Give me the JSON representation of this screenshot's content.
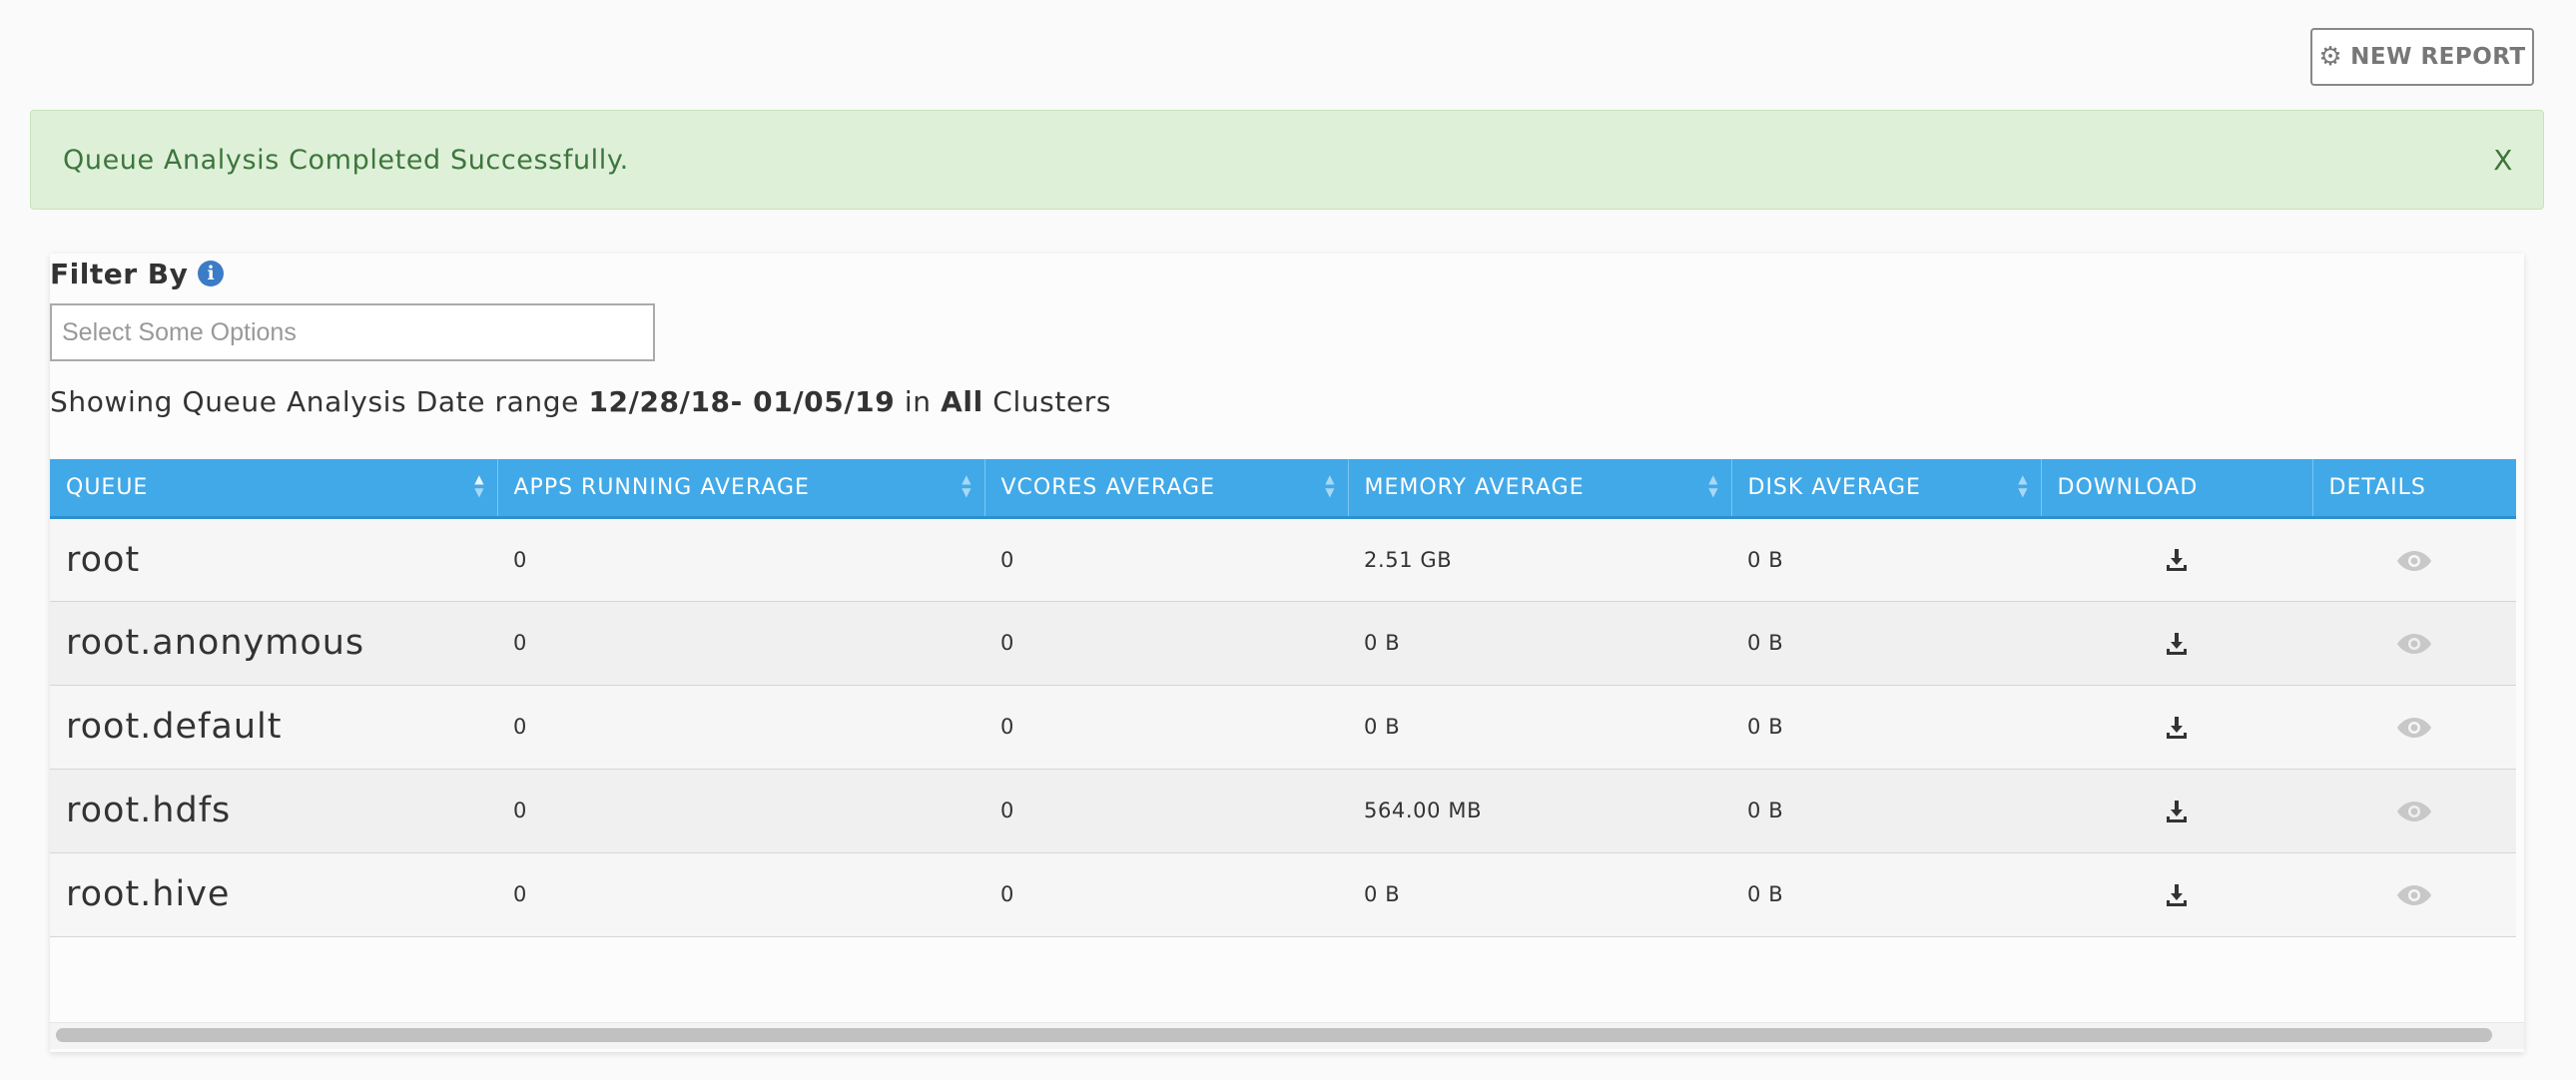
{
  "toolbar": {
    "new_report_label": "NEW REPORT",
    "new_report_icon": "gear-icon"
  },
  "alert": {
    "message": "Queue Analysis Completed Successfully.",
    "close_label": "X",
    "color": "#3c763d",
    "background": "#dff0d8"
  },
  "filter": {
    "label": "Filter By",
    "info_icon": "info-icon",
    "placeholder": "Select Some Options"
  },
  "summary": {
    "prefix": "Showing Queue Analysis Date range",
    "date_range": "12/28/18- 01/05/19",
    "in": "in",
    "scope": "All",
    "suffix": "Clusters"
  },
  "table": {
    "header_color": "#41a9e8",
    "columns": [
      "QUEUE",
      "APPS RUNNING AVERAGE",
      "VCORES AVERAGE",
      "MEMORY AVERAGE",
      "DISK AVERAGE",
      "DOWNLOAD",
      "DETAILS"
    ],
    "rows": [
      {
        "queue": "root",
        "apps": "0",
        "vcores": "0",
        "memory": "2.51 GB",
        "disk": "0 B"
      },
      {
        "queue": "root.anonymous",
        "apps": "0",
        "vcores": "0",
        "memory": "0 B",
        "disk": "0 B"
      },
      {
        "queue": "root.default",
        "apps": "0",
        "vcores": "0",
        "memory": "0 B",
        "disk": "0 B"
      },
      {
        "queue": "root.hdfs",
        "apps": "0",
        "vcores": "0",
        "memory": "564.00 MB",
        "disk": "0 B"
      },
      {
        "queue": "root.hive",
        "apps": "0",
        "vcores": "0",
        "memory": "0 B",
        "disk": "0 B"
      }
    ]
  }
}
